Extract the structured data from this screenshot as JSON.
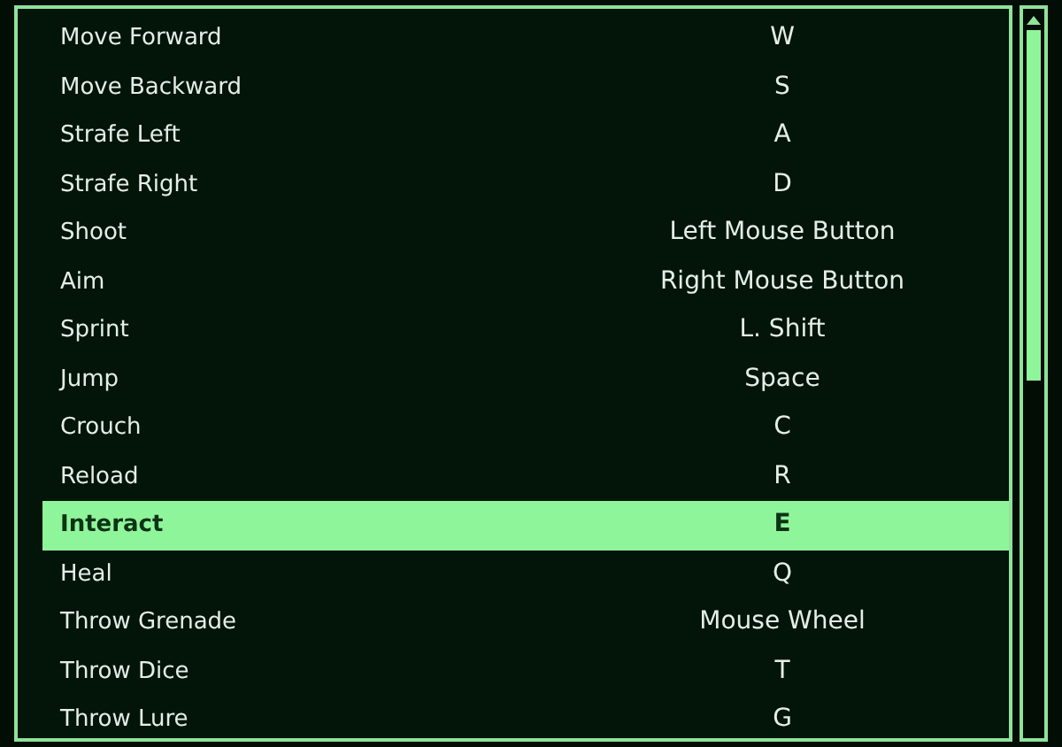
{
  "bindings": [
    {
      "action": "Move Forward",
      "key": "W",
      "selected": false
    },
    {
      "action": "Move Backward",
      "key": "S",
      "selected": false
    },
    {
      "action": "Strafe Left",
      "key": "A",
      "selected": false
    },
    {
      "action": "Strafe Right",
      "key": "D",
      "selected": false
    },
    {
      "action": "Shoot",
      "key": "Left Mouse Button",
      "selected": false
    },
    {
      "action": "Aim",
      "key": "Right Mouse Button",
      "selected": false
    },
    {
      "action": "Sprint",
      "key": "L. Shift",
      "selected": false
    },
    {
      "action": "Jump",
      "key": "Space",
      "selected": false
    },
    {
      "action": "Crouch",
      "key": "C",
      "selected": false
    },
    {
      "action": "Reload",
      "key": "R",
      "selected": false
    },
    {
      "action": "Interact",
      "key": "E",
      "selected": true
    },
    {
      "action": "Heal",
      "key": "Q",
      "selected": false
    },
    {
      "action": "Throw Grenade",
      "key": "Mouse Wheel",
      "selected": false
    },
    {
      "action": "Throw Dice",
      "key": "T",
      "selected": false
    },
    {
      "action": "Throw Lure",
      "key": "G",
      "selected": false
    }
  ]
}
